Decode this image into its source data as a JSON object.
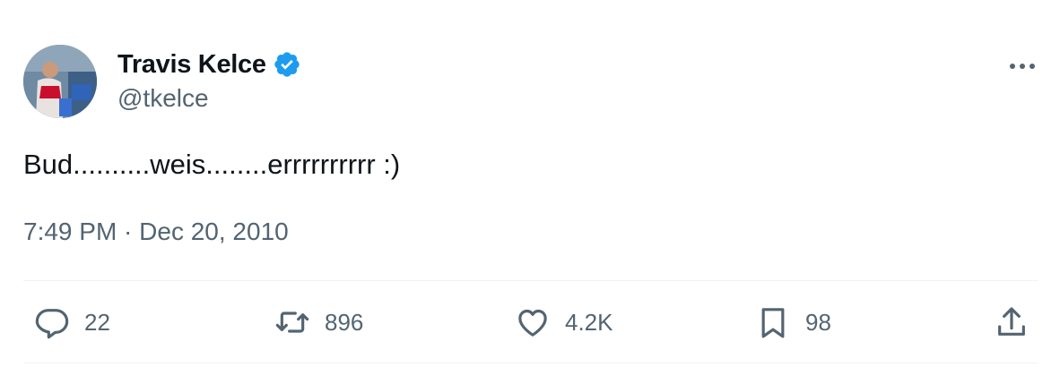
{
  "author": {
    "display_name": "Travis Kelce",
    "handle": "@tkelce",
    "verified_icon": "verified-badge-icon",
    "verified_color": "#1d9bf0"
  },
  "tweet": {
    "text": "Bud..........weis........errrrrrrrrr :)",
    "timestamp": "7:49 PM · Dec 20, 2010"
  },
  "actions": {
    "reply": {
      "icon": "reply-icon",
      "count": "22"
    },
    "retweet": {
      "icon": "retweet-icon",
      "count": "896"
    },
    "like": {
      "icon": "heart-icon",
      "count": "4.2K"
    },
    "bookmark": {
      "icon": "bookmark-icon",
      "count": "98"
    },
    "share": {
      "icon": "share-icon"
    }
  },
  "colors": {
    "text_primary": "#0f1419",
    "text_secondary": "#536471",
    "divider": "#eff3f4"
  }
}
